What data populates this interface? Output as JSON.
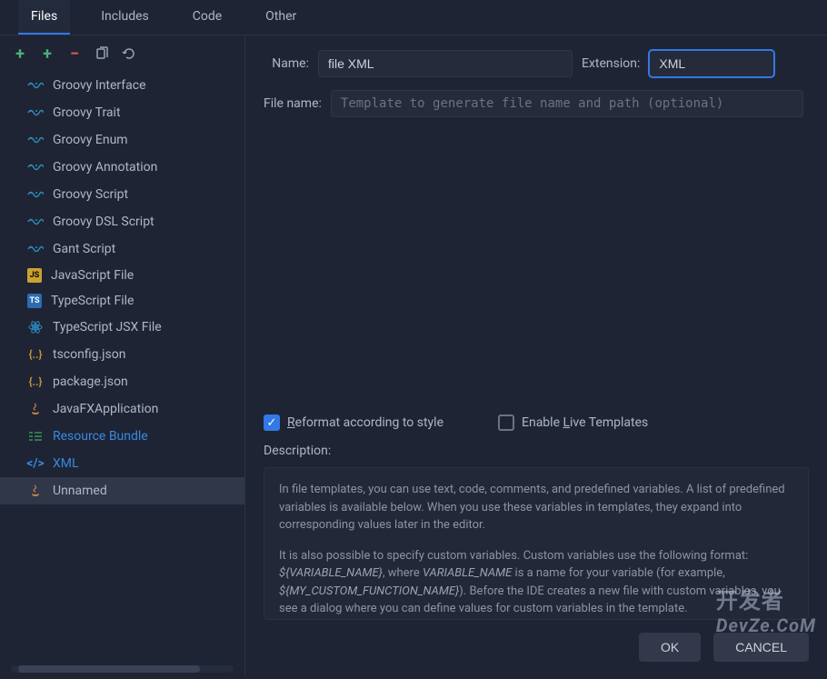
{
  "tabs": [
    {
      "label": "Files",
      "active": true
    },
    {
      "label": "Includes",
      "active": false
    },
    {
      "label": "Code",
      "active": false
    },
    {
      "label": "Other",
      "active": false
    }
  ],
  "toolbar": {
    "add": "+",
    "add2": "+",
    "remove": "−",
    "copy_icon": "copy",
    "reset_icon": "reset"
  },
  "file_list": [
    {
      "label": "Groovy Interface",
      "icon": "groovy"
    },
    {
      "label": "Groovy Trait",
      "icon": "groovy"
    },
    {
      "label": "Groovy Enum",
      "icon": "groovy"
    },
    {
      "label": "Groovy Annotation",
      "icon": "groovy"
    },
    {
      "label": "Groovy Script",
      "icon": "groovy"
    },
    {
      "label": "Groovy DSL Script",
      "icon": "groovy"
    },
    {
      "label": "Gant Script",
      "icon": "groovy"
    },
    {
      "label": "JavaScript File",
      "icon": "js"
    },
    {
      "label": "TypeScript File",
      "icon": "ts"
    },
    {
      "label": "TypeScript JSX File",
      "icon": "tsx"
    },
    {
      "label": "tsconfig.json",
      "icon": "json"
    },
    {
      "label": "package.json",
      "icon": "json"
    },
    {
      "label": "JavaFXApplication",
      "icon": "java"
    },
    {
      "label": "Resource Bundle",
      "icon": "bundle",
      "highlight": true
    },
    {
      "label": "XML",
      "icon": "xml",
      "highlight": true
    },
    {
      "label": "Unnamed",
      "icon": "java",
      "selected": true
    }
  ],
  "form": {
    "name_label": "Name:",
    "name_value": "file XML",
    "ext_label": "Extension:",
    "ext_value": "XML",
    "filename_label": "File name:",
    "filename_placeholder": "Template to generate file name and path (optional)"
  },
  "options": {
    "reformat_label_pre": "R",
    "reformat_label": "eformat according to style",
    "reformat_checked": true,
    "live_label_pre": "Enable ",
    "live_label_u": "L",
    "live_label_post": "ive Templates",
    "live_checked": false
  },
  "description": {
    "label": "Description:",
    "p1": "In file templates, you can use text, code, comments, and predefined variables. A list of predefined variables is available below. When you use these variables in templates, they expand into corresponding values later in the editor.",
    "p2_a": "It is also possible to specify custom variables. Custom variables use the following format: ",
    "p2_i1": "${VARIABLE_NAME}",
    "p2_b": ", where ",
    "p2_i2": "VARIABLE_NAME",
    "p2_c": " is a name for your variable (for example, ",
    "p2_i3": "${MY_CUSTOM_FUNCTION_NAME}",
    "p2_d": "). Before the IDE creates a new file with custom variables, you see a dialog where you can define values for custom variables in the template."
  },
  "buttons": {
    "ok": "OK",
    "cancel": "CANCEL"
  },
  "watermark": {
    "top": "开发者",
    "bot": "DevZe.CoM"
  }
}
